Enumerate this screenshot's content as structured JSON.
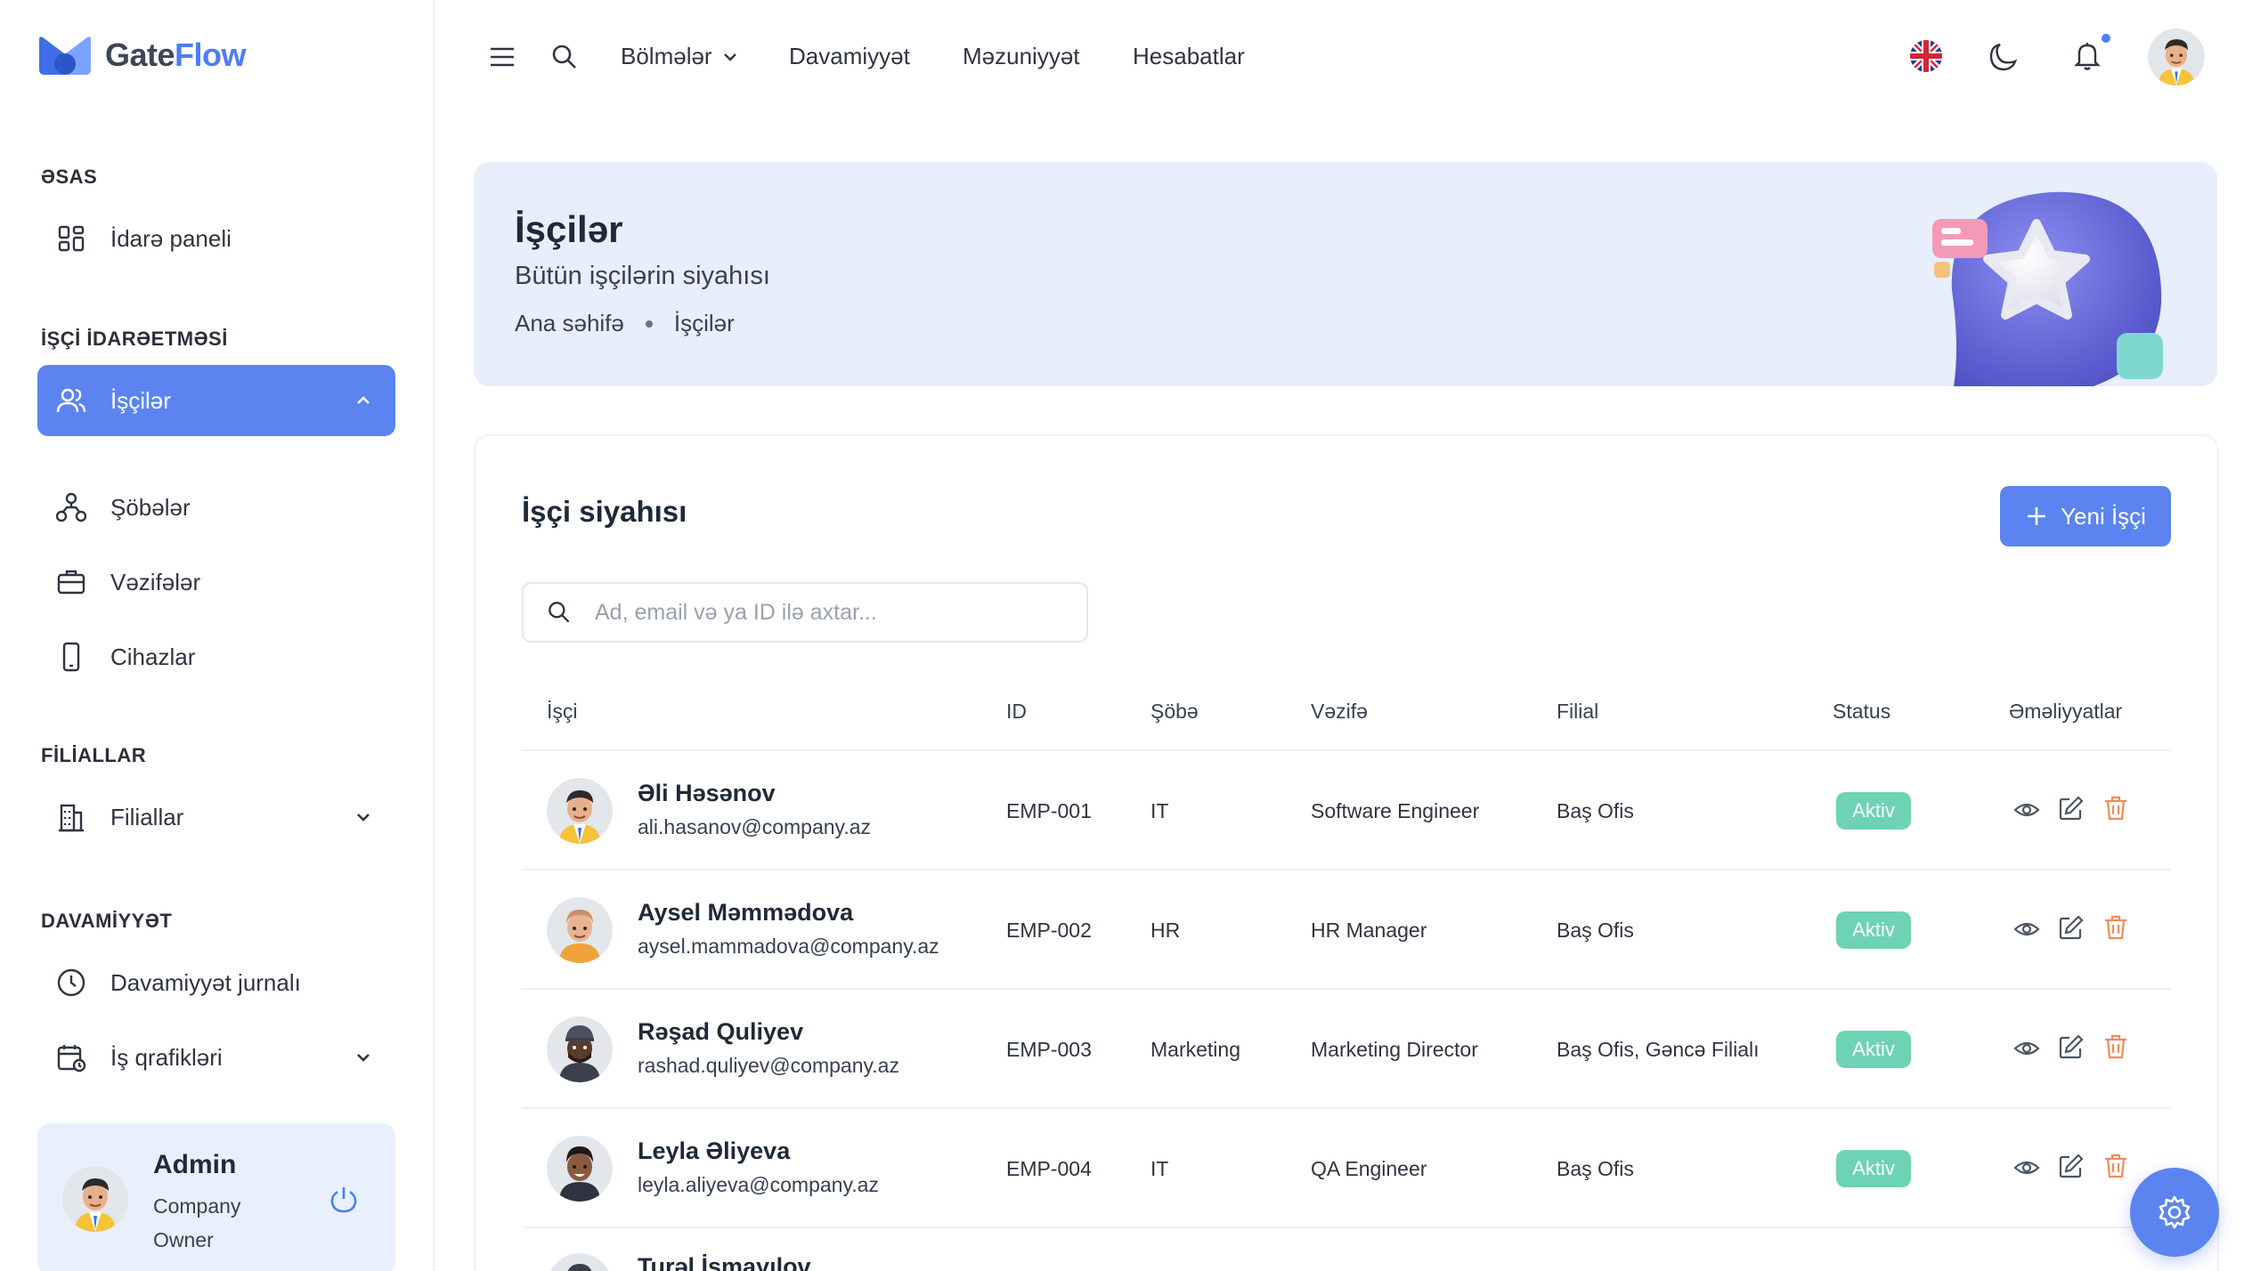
{
  "brand": {
    "name_part1": "Gate",
    "name_part2": "Flow"
  },
  "sidebar": {
    "sections": [
      {
        "title": "ƏSAS"
      },
      {
        "title": "İŞÇİ İDARƏETMƏSİ"
      },
      {
        "title": "FİLİALLAR"
      },
      {
        "title": "DAVAMİYYƏT"
      }
    ],
    "items": [
      {
        "label": "İdarə paneli",
        "icon": "dashboard-icon"
      },
      {
        "label": "İşçilər",
        "icon": "users-icon",
        "active": true
      },
      {
        "label": "Şöbələr",
        "icon": "org-icon"
      },
      {
        "label": "Vəzifələr",
        "icon": "briefcase-icon"
      },
      {
        "label": "Cihazlar",
        "icon": "device-icon"
      },
      {
        "label": "Filiallar",
        "icon": "building-icon"
      },
      {
        "label": "Davamiyyət jurnalı",
        "icon": "clock-icon"
      },
      {
        "label": "İş qrafikləri",
        "icon": "calendar-icon"
      }
    ],
    "user": {
      "name": "Admin",
      "role": "Company Owner"
    }
  },
  "topbar": {
    "links": [
      "Bölmələr",
      "Davamiyyət",
      "Məzuniyyət",
      "Hesabatlar"
    ]
  },
  "hero": {
    "title": "İşçilər",
    "subtitle": "Bütün işçilərin siyahısı",
    "breadcrumbs": [
      "Ana səhifə",
      "İşçilər"
    ]
  },
  "card": {
    "title": "İşçi siyahısı",
    "new_button": "Yeni İşçi",
    "search_placeholder": "Ad, email və ya ID ilə axtar...",
    "columns": [
      "İşçi",
      "ID",
      "Şöbə",
      "Vəzifə",
      "Filial",
      "Status",
      "Əməliyyatlar"
    ],
    "rows": [
      {
        "name": "Əli Həsənov",
        "email": "ali.hasanov@company.az",
        "id": "EMP-001",
        "department": "IT",
        "position": "Software Engineer",
        "branch": "Baş Ofis",
        "status": "Aktiv"
      },
      {
        "name": "Aysel Məmmədova",
        "email": "aysel.mammadova@company.az",
        "id": "EMP-002",
        "department": "HR",
        "position": "HR Manager",
        "branch": "Baş Ofis",
        "status": "Aktiv"
      },
      {
        "name": "Rəşad Quliyev",
        "email": "rashad.quliyev@company.az",
        "id": "EMP-003",
        "department": "Marketing",
        "position": "Marketing Director",
        "branch": "Baş Ofis, Gəncə Filialı",
        "status": "Aktiv"
      },
      {
        "name": "Leyla Əliyeva",
        "email": "leyla.aliyeva@company.az",
        "id": "EMP-004",
        "department": "IT",
        "position": "QA Engineer",
        "branch": "Baş Ofis",
        "status": "Aktiv"
      },
      {
        "name": "Turəl İsmayılov",
        "email": "",
        "id": "",
        "department": "",
        "position": "",
        "branch": "",
        "status": ""
      }
    ]
  },
  "colors": {
    "accent": "#5b84f0",
    "status_active": "#6ed3b4",
    "delete": "#f08c5a",
    "hero_bg": "#e8eefb"
  }
}
